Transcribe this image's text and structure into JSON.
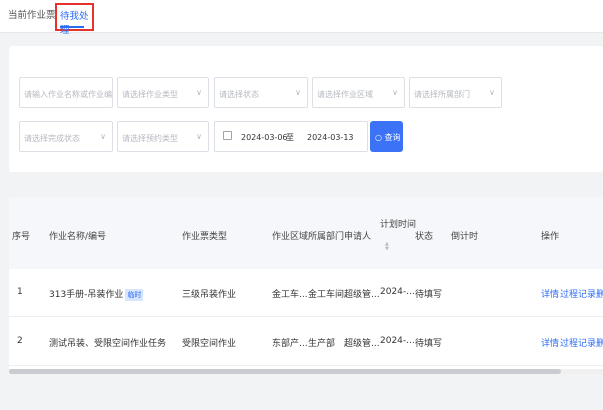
{
  "tabs": [
    "当前作业票",
    "待我处理"
  ],
  "filters": {
    "name_placeholder": "请输入作业名称或作业编号",
    "type_placeholder": "请选择作业类型",
    "status_placeholder": "请选择状态",
    "area_placeholder": "请选择作业区域",
    "dept_placeholder": "请选择所属部门",
    "complete_placeholder": "请选择完成状态",
    "risk_placeholder": "请选择预约类型",
    "date_start": "2024-03-06",
    "date_sep": "至",
    "date_end": "2024-03-13",
    "query_label": "查询"
  },
  "table": {
    "headers": [
      "序号",
      "作业名称/编号",
      "作业票类型",
      "作业区域",
      "所属部门",
      "申请人",
      "计划时间",
      "状态",
      "倒计时",
      "操作"
    ],
    "rows": [
      {
        "index": "1",
        "name": "313手册-吊装作业",
        "tag": "临时",
        "type": "三级吊装作业",
        "area": "金工车...",
        "dept": "金工车间",
        "applicant": "超级管...",
        "time": "2024-...",
        "status": "待填写",
        "actions": [
          "详情",
          "过程记录",
          "删"
        ]
      },
      {
        "index": "2",
        "name": "测试吊装、受限空间作业任务",
        "tag": "",
        "type": "受限空间作业",
        "area": "东部产...",
        "dept": "生产部",
        "applicant": "超级管...",
        "time": "2024-...",
        "status": "待填写",
        "actions": [
          "详情",
          "过程记录",
          "删"
        ]
      }
    ]
  }
}
